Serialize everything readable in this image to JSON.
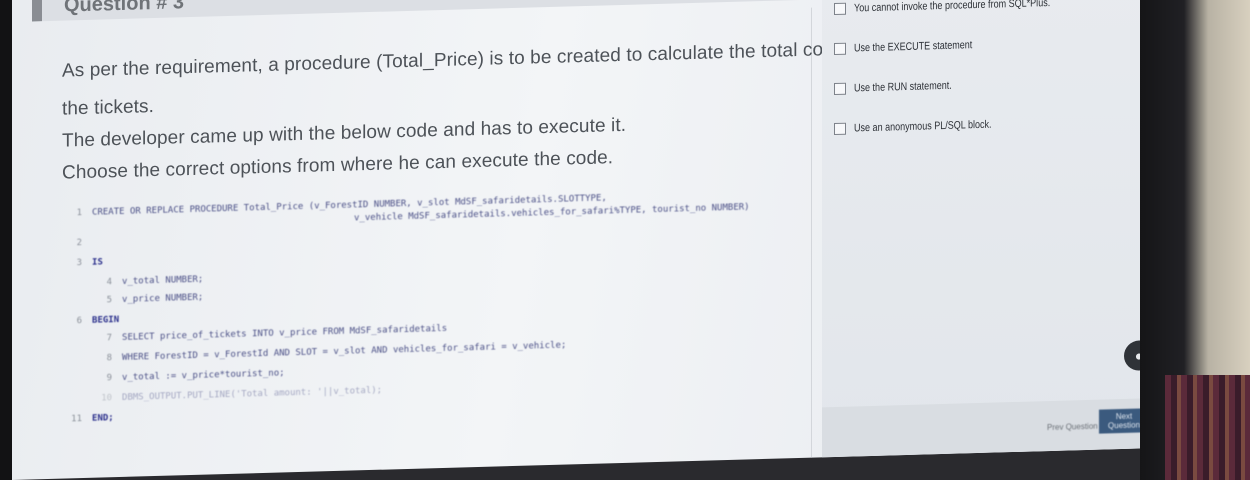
{
  "question": {
    "header": "Question # 3",
    "lines": [
      "As per the requirement, a procedure (Total_Price) is to be created to calculate the total cost of",
      "the tickets.",
      "The developer came up with the below code and has to execute it.",
      "Choose the correct options from where he can execute the code."
    ]
  },
  "code": [
    {
      "n": "1",
      "text": "CREATE OR REPLACE PROCEDURE Total_Price (v_ForestID NUMBER, v_slot MdSF_safaridetails.SLOTTYPE,"
    },
    {
      "n": "",
      "text": "v_vehicle MdSF_safaridetails.vehicles_for_safari%TYPE, tourist_no NUMBER)"
    },
    {
      "n": "2",
      "text": ""
    },
    {
      "n": "3",
      "text": "IS"
    },
    {
      "n": "4",
      "text": "v_total NUMBER;"
    },
    {
      "n": "5",
      "text": "v_price NUMBER;"
    },
    {
      "n": "6",
      "text": "BEGIN"
    },
    {
      "n": "7",
      "text": "SELECT price_of_tickets INTO v_price FROM MdSF_safaridetails"
    },
    {
      "n": "8",
      "text": "WHERE ForestID = v_ForestId AND SLOT = v_slot AND vehicles_for_safari = v_vehicle;"
    },
    {
      "n": "9",
      "text": "v_total := v_price*tourist_no;"
    },
    {
      "n": "10",
      "text": "DBMS_OUTPUT.PUT_LINE('Total amount: '||v_total);"
    },
    {
      "n": "11",
      "text": "END;"
    }
  ],
  "options": [
    {
      "label": "You cannot invoke the procedure from SQL*Plus."
    },
    {
      "label": "Use the EXECUTE statement"
    },
    {
      "label": "Use the RUN statement."
    },
    {
      "label": "Use an anonymous PL/SQL block."
    }
  ],
  "footer": {
    "prev_label": "Prev Question",
    "next_label": "Next Question",
    "chat_icon": "chat-icon"
  }
}
